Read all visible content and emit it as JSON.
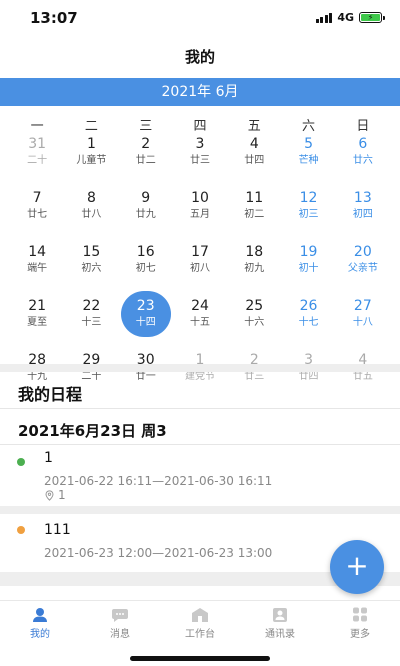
{
  "status": {
    "time": "13:07",
    "network": "4G"
  },
  "header": {
    "title": "我的"
  },
  "calendar": {
    "month_label": "2021年 6月",
    "weekdays": [
      "一",
      "二",
      "三",
      "四",
      "五",
      "六",
      "日"
    ],
    "days": [
      {
        "num": "31",
        "sub": "二十",
        "muted": true
      },
      {
        "num": "1",
        "sub": "儿童节"
      },
      {
        "num": "2",
        "sub": "廿二"
      },
      {
        "num": "3",
        "sub": "廿三"
      },
      {
        "num": "4",
        "sub": "廿四"
      },
      {
        "num": "5",
        "sub": "芒种",
        "weekend": true
      },
      {
        "num": "6",
        "sub": "廿六",
        "weekend": true
      },
      {
        "num": "7",
        "sub": "廿七"
      },
      {
        "num": "8",
        "sub": "廿八"
      },
      {
        "num": "9",
        "sub": "廿九"
      },
      {
        "num": "10",
        "sub": "五月"
      },
      {
        "num": "11",
        "sub": "初二"
      },
      {
        "num": "12",
        "sub": "初三",
        "weekend": true
      },
      {
        "num": "13",
        "sub": "初四",
        "weekend": true
      },
      {
        "num": "14",
        "sub": "端午"
      },
      {
        "num": "15",
        "sub": "初六"
      },
      {
        "num": "16",
        "sub": "初七"
      },
      {
        "num": "17",
        "sub": "初八"
      },
      {
        "num": "18",
        "sub": "初九"
      },
      {
        "num": "19",
        "sub": "初十",
        "weekend": true
      },
      {
        "num": "20",
        "sub": "父亲节",
        "weekend": true
      },
      {
        "num": "21",
        "sub": "夏至"
      },
      {
        "num": "22",
        "sub": "十三"
      },
      {
        "num": "23",
        "sub": "十四",
        "selected": true
      },
      {
        "num": "24",
        "sub": "十五"
      },
      {
        "num": "25",
        "sub": "十六"
      },
      {
        "num": "26",
        "sub": "十七",
        "weekend": true
      },
      {
        "num": "27",
        "sub": "十八",
        "weekend": true
      },
      {
        "num": "28",
        "sub": "十九"
      },
      {
        "num": "29",
        "sub": "二十"
      },
      {
        "num": "30",
        "sub": "廿一"
      },
      {
        "num": "1",
        "sub": "建党节",
        "muted": true
      },
      {
        "num": "2",
        "sub": "廿三",
        "muted": true
      },
      {
        "num": "3",
        "sub": "廿四",
        "muted": true
      },
      {
        "num": "4",
        "sub": "廿五",
        "muted": true
      }
    ]
  },
  "schedule": {
    "section_title": "我的日程",
    "date_heading": "2021年6月23日 周3",
    "events": [
      {
        "title": "1",
        "time": "2021-06-22 16:11—2021-06-30 16:11",
        "location": "1",
        "dot_color": "#4caf50"
      },
      {
        "title": "111",
        "time": "2021-06-23 12:00—2021-06-23 13:00",
        "dot_color": "#f0a040"
      }
    ]
  },
  "fab": {
    "label": "+"
  },
  "tabs": [
    {
      "label": "我的",
      "icon": "user-icon",
      "active": true
    },
    {
      "label": "消息",
      "icon": "message-icon"
    },
    {
      "label": "工作台",
      "icon": "workbench-icon"
    },
    {
      "label": "通讯录",
      "icon": "contacts-icon"
    },
    {
      "label": "更多",
      "icon": "more-icon"
    }
  ],
  "colors": {
    "accent": "#4a90e2",
    "weekend": "#3a8ee6"
  }
}
